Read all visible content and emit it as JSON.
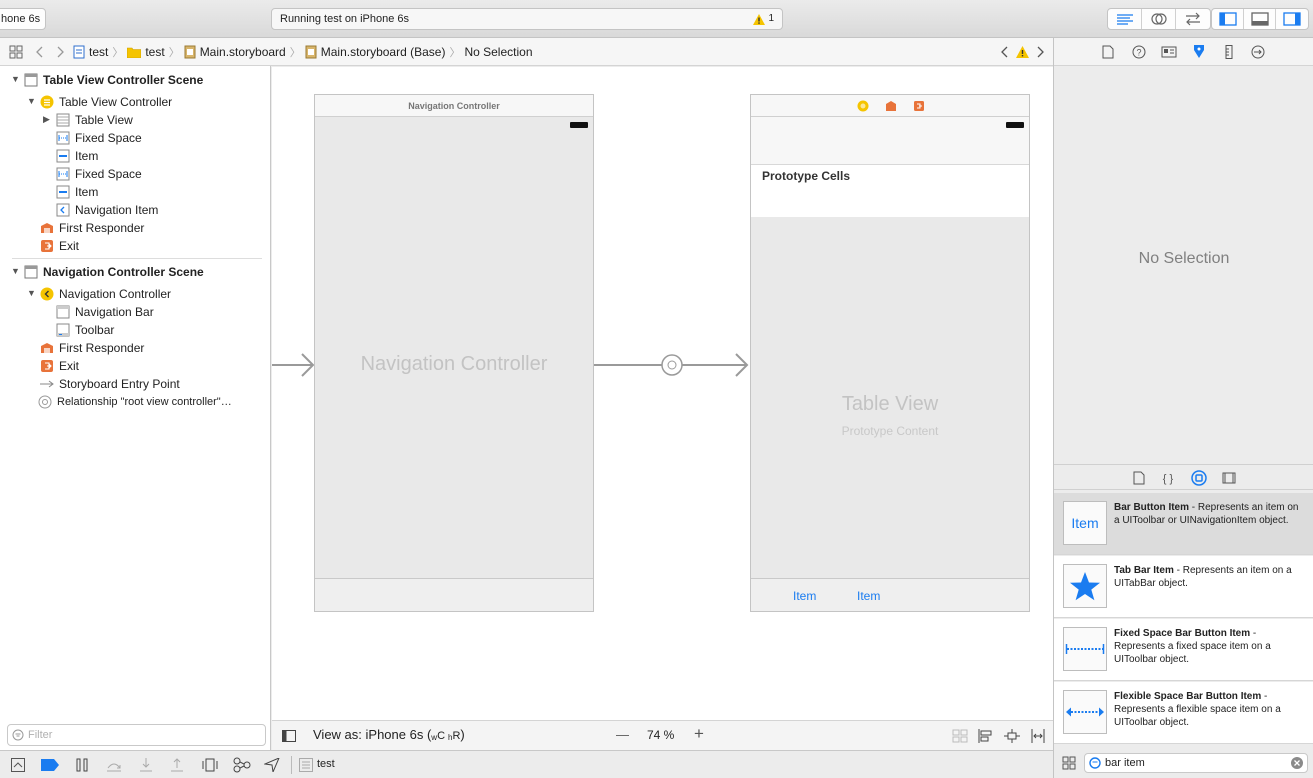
{
  "toolbar": {
    "scheme_label": "hone 6s",
    "status_text": "Running test on iPhone 6s",
    "warning_count": "1"
  },
  "jumpbar": {
    "crumbs": [
      "test",
      "test",
      "Main.storyboard",
      "Main.storyboard (Base)",
      "No Selection"
    ]
  },
  "outline": {
    "rows": [
      "Table View Controller Scene",
      "Table View Controller",
      "Table View",
      "Fixed Space",
      "Item",
      "Fixed Space",
      "Item",
      "Navigation Item",
      "First Responder",
      "Exit",
      "Navigation Controller Scene",
      "Navigation Controller",
      "Navigation Bar",
      "Toolbar",
      "First Responder",
      "Exit",
      "Storyboard Entry Point",
      "Relationship \"root view controller\"…"
    ],
    "filter_placeholder": "Filter"
  },
  "canvas": {
    "nav_scene_title": "Navigation Controller",
    "nav_scene_label": "Navigation Controller",
    "table_prototype_cells": "Prototype Cells",
    "table_view_label": "Table View",
    "table_prototype_content": "Prototype Content",
    "toolbar_item_1": "Item",
    "toolbar_item_2": "Item"
  },
  "canvas_bottom": {
    "view_as": "View as: iPhone 6s (",
    "size_w": "w",
    "size_c": "C",
    "size_h": "h",
    "size_r": "R",
    "size_close": ")",
    "zoom_minus": "—",
    "zoom_level": "74 %",
    "zoom_plus": "+"
  },
  "debug": {
    "target": "test"
  },
  "inspector": {
    "no_selection": "No Selection",
    "library": [
      {
        "thumb": "Item",
        "title": "Bar Button Item",
        "desc": " - Represents an item on a UIToolbar or UINavigationItem object."
      },
      {
        "thumb": "",
        "title": "Tab Bar Item",
        "desc": " - Represents an item on a UITabBar object."
      },
      {
        "thumb": "",
        "title": "Fixed Space Bar Button Item",
        "desc": " - Represents a fixed space item on a UIToolbar object."
      },
      {
        "thumb": "",
        "title": "Flexible Space Bar Button Item",
        "desc": " - Represents a flexible space item on a UIToolbar object."
      }
    ],
    "search_value": "bar item"
  },
  "colors": {
    "accent": "#1a7cf0",
    "warning": "#f5c400",
    "selected_row": "#dcdcdc"
  }
}
